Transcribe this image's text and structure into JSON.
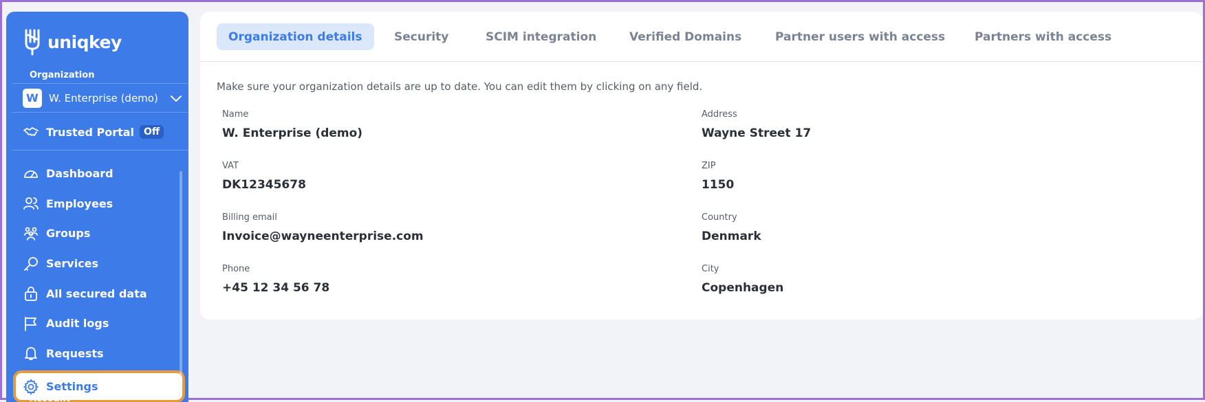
{
  "app": {
    "logo_text": "uniqkey"
  },
  "sidebar": {
    "org_label": "Organization",
    "org_avatar": "W",
    "org_name": "W. Enterprise (demo)",
    "trusted_portal_label": "Trusted Portal",
    "trusted_portal_status": "Off",
    "items": [
      {
        "label": "Dashboard",
        "icon": "dashboard-icon"
      },
      {
        "label": "Employees",
        "icon": "employees-icon"
      },
      {
        "label": "Groups",
        "icon": "groups-icon"
      },
      {
        "label": "Services",
        "icon": "key-icon"
      },
      {
        "label": "All secured data",
        "icon": "lock-icon"
      },
      {
        "label": "Audit logs",
        "icon": "flag-icon"
      },
      {
        "label": "Requests",
        "icon": "bell-icon"
      },
      {
        "label": "Settings",
        "icon": "gear-icon"
      }
    ],
    "account_label": "Account"
  },
  "tabs": [
    {
      "label": "Organization details"
    },
    {
      "label": "Security"
    },
    {
      "label": "SCIM integration"
    },
    {
      "label": "Verified Domains"
    },
    {
      "label": "Partner users with access"
    },
    {
      "label": "Partners with access"
    }
  ],
  "details": {
    "intro": "Make sure your organization details are up to date. You can edit them by clicking on any field.",
    "name": {
      "label": "Name",
      "value": "W. Enterprise (demo)"
    },
    "vat": {
      "label": "VAT",
      "value": "DK12345678"
    },
    "billing_email": {
      "label": "Billing email",
      "value": "Invoice@wayneenterprise.com"
    },
    "phone": {
      "label": "Phone",
      "value": "+45 12 34 56 78"
    },
    "address": {
      "label": "Address",
      "value": "Wayne Street 17"
    },
    "zip": {
      "label": "ZIP",
      "value": "1150"
    },
    "country": {
      "label": "Country",
      "value": "Denmark"
    },
    "city": {
      "label": "City",
      "value": "Copenhagen"
    }
  },
  "colors": {
    "sidebar_bg": "#3d7be8",
    "active_tab_bg": "#dbe7fb",
    "highlight_border": "#e49a3f",
    "frame_border": "#9b6fd8"
  }
}
